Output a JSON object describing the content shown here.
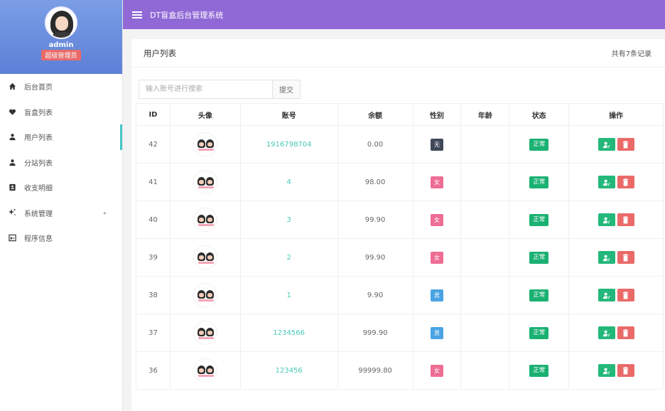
{
  "app": {
    "title": "DT盲盒后台管理系统"
  },
  "profile": {
    "name": "admin",
    "role": "超级管理员"
  },
  "menu": [
    {
      "label": "后台首页",
      "icon": "home-icon"
    },
    {
      "label": "盲盒列表",
      "icon": "heart-icon"
    },
    {
      "label": "用户列表",
      "icon": "user-icon",
      "active": true
    },
    {
      "label": "分站列表",
      "icon": "user-icon"
    },
    {
      "label": "收支明细",
      "icon": "ledger-icon"
    },
    {
      "label": "系统管理",
      "icon": "settings-icon",
      "has_caret": true
    },
    {
      "label": "程序信息",
      "icon": "info-window-icon"
    }
  ],
  "card": {
    "title": "用户列表",
    "record_count": "共有7条记录"
  },
  "search": {
    "placeholder": "输入账号进行搜索",
    "button": "提交"
  },
  "table": {
    "columns": [
      "ID",
      "头像",
      "账号",
      "余额",
      "性别",
      "年龄",
      "状态",
      "操作"
    ],
    "rows": [
      {
        "id": "42",
        "account": "1916798704",
        "balance": "0.00",
        "gender": "无",
        "gender_color": "#3f4857",
        "age": "",
        "status": "正常"
      },
      {
        "id": "41",
        "account": "4",
        "balance": "98.00",
        "gender": "女",
        "gender_color": "#ee6d95",
        "age": "",
        "status": "正常"
      },
      {
        "id": "40",
        "account": "3",
        "balance": "99.90",
        "gender": "女",
        "gender_color": "#ee6d95",
        "age": "",
        "status": "正常"
      },
      {
        "id": "39",
        "account": "2",
        "balance": "99.90",
        "gender": "女",
        "gender_color": "#ee6d95",
        "age": "",
        "status": "正常"
      },
      {
        "id": "38",
        "account": "1",
        "balance": "9.90",
        "gender": "男",
        "gender_color": "#4aa3e3",
        "age": "",
        "status": "正常"
      },
      {
        "id": "37",
        "account": "1234566",
        "balance": "999.90",
        "gender": "男",
        "gender_color": "#4aa3e3",
        "age": "",
        "status": "正常"
      },
      {
        "id": "36",
        "account": "123456",
        "balance": "99999.80",
        "gender": "女",
        "gender_color": "#ee6d95",
        "age": "",
        "status": "正常"
      }
    ]
  },
  "colors": {
    "header": "#9069d6",
    "accent": "#45c6c5",
    "status_ok": "#1ab172",
    "danger": "#ea6a6a"
  }
}
